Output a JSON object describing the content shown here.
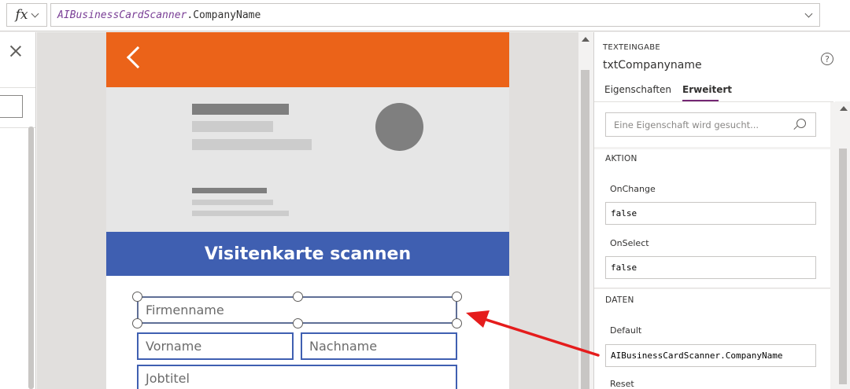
{
  "formula_bar": {
    "fx_label": "fx",
    "formula_identifier": "AIBusinessCardScanner",
    "formula_dot": ".",
    "formula_property": "CompanyName"
  },
  "app": {
    "scan_title": "Visitenkarte scannen",
    "fields": {
      "company": "Firmenname",
      "first_name": "Vorname",
      "last_name": "Nachname",
      "job_title": "Jobtitel"
    }
  },
  "properties": {
    "control_type": "TEXTEINGABE",
    "control_name": "txtCompanyname",
    "help": "?",
    "tabs": {
      "properties": "Eigenschaften",
      "advanced": "Erweitert"
    },
    "search_placeholder": "Eine Eigenschaft wird gesucht...",
    "action_section": "AKTION",
    "onchange_label": "OnChange",
    "onchange_value": "false",
    "onselect_label": "OnSelect",
    "onselect_value": "false",
    "data_section": "DATEN",
    "default_label": "Default",
    "default_value": "AIBusinessCardScanner.CompanyName",
    "reset_label": "Reset"
  },
  "colors": {
    "header_orange": "#eb6319",
    "banner_blue": "#3f5fb1",
    "accent_purple": "#742774",
    "arrow_red": "#e51c1c"
  }
}
